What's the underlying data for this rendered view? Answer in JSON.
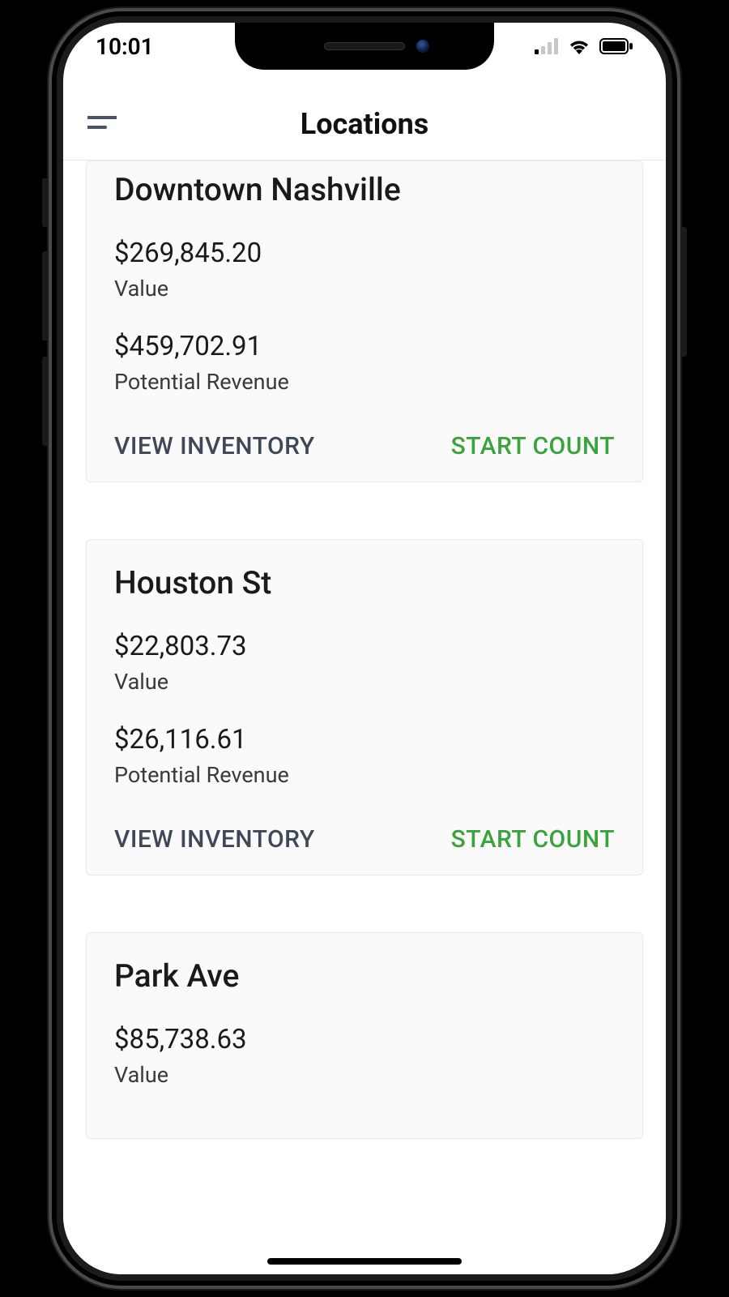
{
  "status": {
    "time": "10:01"
  },
  "header": {
    "title": "Locations"
  },
  "labels": {
    "value": "Value",
    "potential_revenue": "Potential Revenue",
    "view_inventory": "VIEW INVENTORY",
    "start_count": "START COUNT"
  },
  "locations": [
    {
      "name": "Downtown Nashville",
      "value": "$269,845.20",
      "potential_revenue": "$459,702.91"
    },
    {
      "name": "Houston St",
      "value": "$22,803.73",
      "potential_revenue": "$26,116.61"
    },
    {
      "name": "Park Ave",
      "value": "$85,738.63"
    }
  ]
}
